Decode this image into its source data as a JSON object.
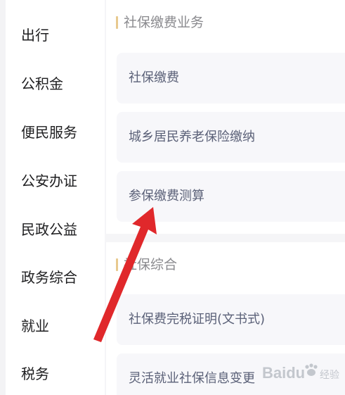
{
  "sidebar": {
    "items": [
      {
        "label": "出行"
      },
      {
        "label": "公积金"
      },
      {
        "label": "便民服务"
      },
      {
        "label": "公安办证"
      },
      {
        "label": "民政公益"
      },
      {
        "label": "政务综合"
      },
      {
        "label": "就业"
      },
      {
        "label": "税务"
      }
    ]
  },
  "sections": [
    {
      "title": "社保缴费业务",
      "cards": [
        {
          "label": "社保缴费"
        },
        {
          "label": "城乡居民养老保险缴纳"
        },
        {
          "label": "参保缴费测算"
        }
      ]
    },
    {
      "title": "社保综合",
      "cards": [
        {
          "label": "社保费完税证明(文书式)"
        },
        {
          "label": "灵活就业社保信息变更"
        }
      ]
    }
  ],
  "colors": {
    "accent_bar": "#e8c98e",
    "arrow": "#e0282b",
    "card_bg": "#f7f7fa"
  },
  "watermark": {
    "brand": "Baidu",
    "text": "经验"
  }
}
